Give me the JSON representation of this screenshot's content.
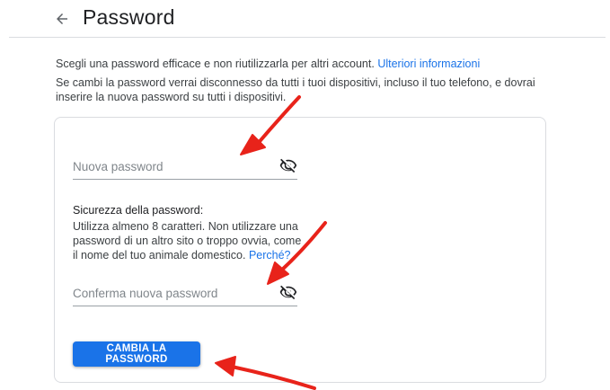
{
  "header": {
    "title": "Password",
    "back_icon": "arrow-left-icon"
  },
  "intro": {
    "line1_text": "Scegli una password efficace e non riutilizzarla per altri account.",
    "line1_link": "Ulteriori informazioni",
    "line2_text": "Se cambi la password verrai disconnesso da tutti i tuoi dispositivi, incluso il tuo telefono, e dovrai inserire la nuova password su tutti i dispositivi."
  },
  "form": {
    "new_password": {
      "placeholder": "Nuova password",
      "value": "",
      "toggle_icon": "eye-off-icon"
    },
    "strength": {
      "title": "Sicurezza della password:",
      "text": "Utilizza almeno 8 caratteri. Non utilizzare una password di un altro sito o troppo ovvia, come il nome del tuo animale domestico.",
      "link": "Perché?"
    },
    "confirm_password": {
      "placeholder": "Conferma nuova password",
      "value": "",
      "toggle_icon": "eye-off-icon"
    },
    "submit_label": "CAMBIA LA PASSWORD"
  },
  "colors": {
    "accent": "#1a73e8",
    "annotation_arrow": "#e8231a",
    "divider": "#dadce0"
  }
}
